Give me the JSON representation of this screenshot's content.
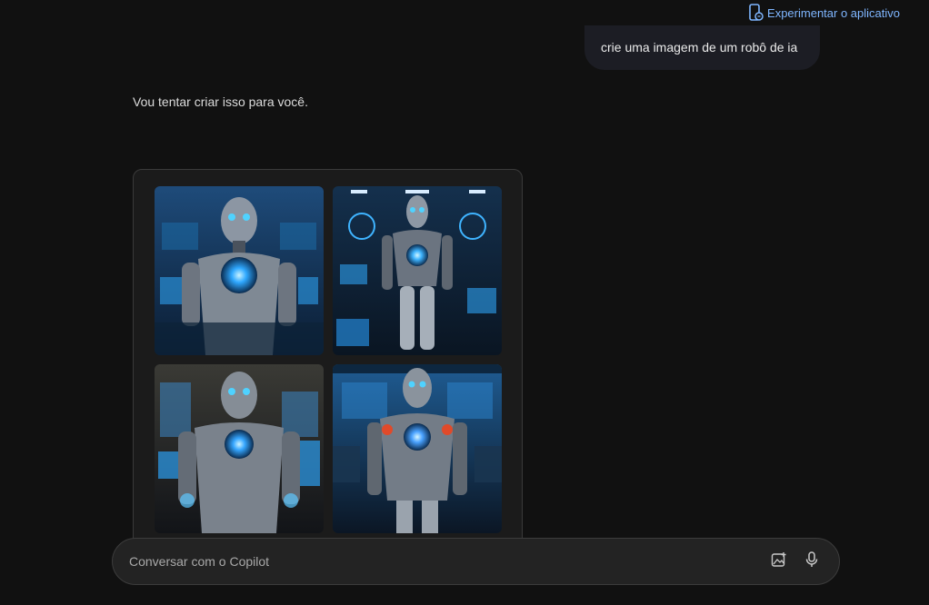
{
  "header": {
    "try_app_label": "Experimentar o aplicativo",
    "try_app_icon": "phone-chat-icon"
  },
  "conversation": {
    "user_message": "crie uma imagem de um robô de ia",
    "assistant_message": "Vou tentar criar isso para você.",
    "generated_images": [
      {
        "icon": "robot-image",
        "accent": "#2fa8ff"
      },
      {
        "icon": "robot-image",
        "accent": "#3fb4ff"
      },
      {
        "icon": "robot-image",
        "accent": "#35a6ff"
      },
      {
        "icon": "robot-image",
        "accent": "#4aa2ff"
      }
    ]
  },
  "composer": {
    "placeholder": "Conversar com o Copilot",
    "image_icon": "add-image-icon",
    "mic_icon": "microphone-icon"
  },
  "colors": {
    "background": "#111111",
    "link": "#7fb6ff",
    "user_bubble": "#1c1d24",
    "composer": "#232323"
  }
}
